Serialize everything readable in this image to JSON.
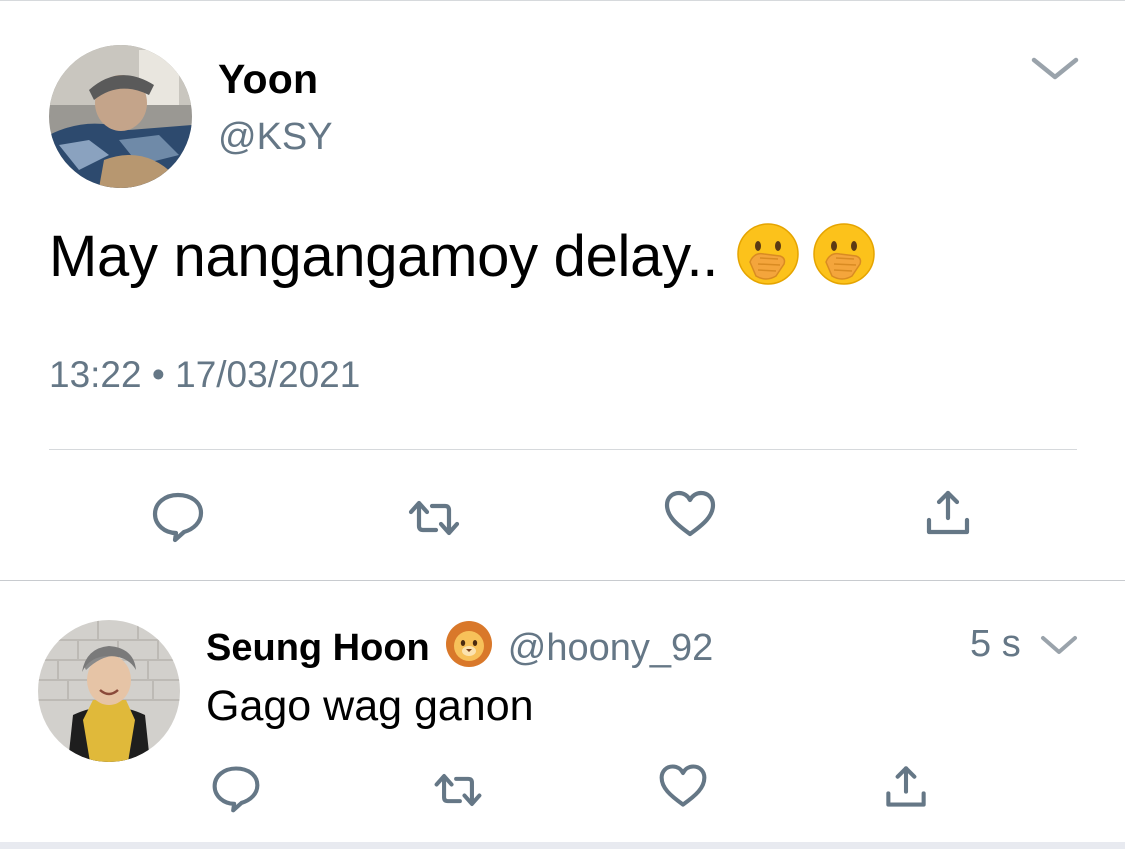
{
  "main_tweet": {
    "display_name": "Yoon",
    "handle": "@KSY",
    "text": "May nangangamoy delay..",
    "emoji_names": [
      "face-with-hand-over-mouth",
      "face-with-hand-over-mouth"
    ],
    "time": "13:22",
    "separator": "•",
    "date": "17/03/2021",
    "actions": [
      "reply-icon",
      "retweet-icon",
      "like-icon",
      "share-icon"
    ]
  },
  "reply": {
    "display_name": "Seung Hoon",
    "name_emoji": "lion-face",
    "handle": "@hoony_92",
    "time_ago": "5 s",
    "text": "Gago wag ganon",
    "actions": [
      "reply-icon",
      "retweet-icon",
      "like-icon",
      "share-icon"
    ]
  },
  "colors": {
    "secondary_text": "#657786",
    "icon": "#657786",
    "divider": "#d6d9dc",
    "background": "#ffffff"
  }
}
